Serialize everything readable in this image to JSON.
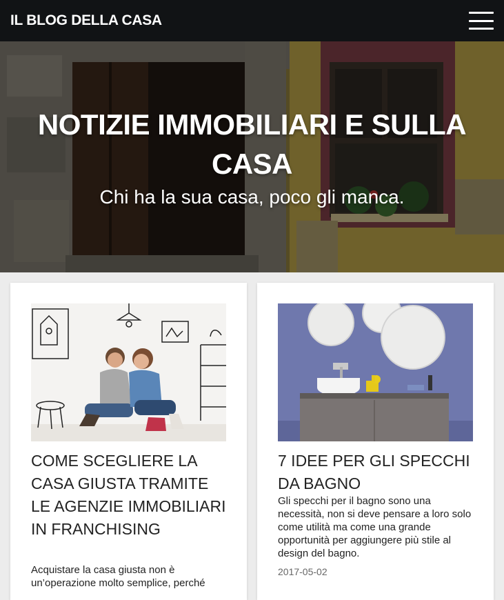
{
  "header": {
    "brand": "IL BLOG DELLA CASA",
    "menu_icon": "hamburger-icon"
  },
  "hero": {
    "title": "NOTIZIE IMMOBILIARI E SULLA CASA",
    "subtitle": "Chi ha la sua casa, poco gli manca."
  },
  "posts": [
    {
      "title": "COME SCEGLIERE LA CASA GIUSTA TRAMITE LE AGENZIE IMMOBILIARI IN FRANCHISING",
      "excerpt": "Acquistare la casa giusta non è un’operazione molto semplice, perché",
      "date": ""
    },
    {
      "title": "7 IDEE PER GLI SPECCHI DA BAGNO",
      "excerpt": "Gli specchi per il bagno sono una necessità, non si deve pensare a loro solo come utilità ma come una grande opportunità per aggiungere più stile al design del bagno.",
      "date": "2017-05-02"
    }
  ],
  "colors": {
    "topbar": "#111315",
    "page_bg": "#ececec",
    "card_bg": "#ffffff"
  }
}
